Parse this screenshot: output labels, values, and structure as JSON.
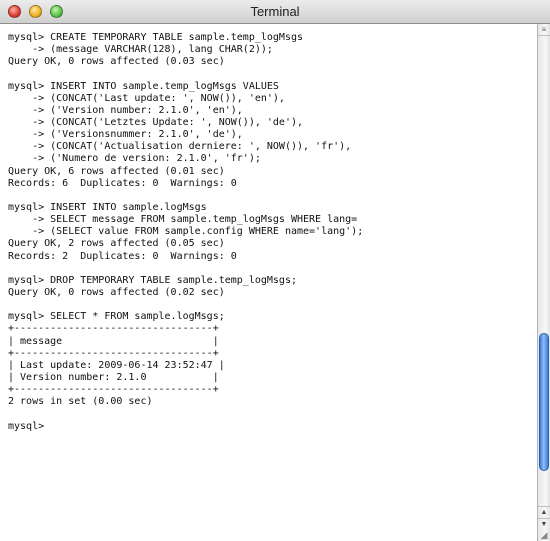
{
  "window": {
    "title": "Terminal"
  },
  "terminal_lines": [
    "mysql> CREATE TEMPORARY TABLE sample.temp_logMsgs",
    "    -> (message VARCHAR(128), lang CHAR(2));",
    "Query OK, 0 rows affected (0.03 sec)",
    "",
    "mysql> INSERT INTO sample.temp_logMsgs VALUES",
    "    -> (CONCAT('Last update: ', NOW()), 'en'),",
    "    -> ('Version number: 2.1.0', 'en'),",
    "    -> (CONCAT('Letztes Update: ', NOW()), 'de'),",
    "    -> ('Versionsnummer: 2.1.0', 'de'),",
    "    -> (CONCAT('Actualisation derniere: ', NOW()), 'fr'),",
    "    -> ('Numero de version: 2.1.0', 'fr');",
    "Query OK, 6 rows affected (0.01 sec)",
    "Records: 6  Duplicates: 0  Warnings: 0",
    "",
    "mysql> INSERT INTO sample.logMsgs",
    "    -> SELECT message FROM sample.temp_logMsgs WHERE lang=",
    "    -> (SELECT value FROM sample.config WHERE name='lang');",
    "Query OK, 2 rows affected (0.05 sec)",
    "Records: 2  Duplicates: 0  Warnings: 0",
    "",
    "mysql> DROP TEMPORARY TABLE sample.temp_logMsgs;",
    "Query OK, 0 rows affected (0.02 sec)",
    "",
    "mysql> SELECT * FROM sample.logMsgs;",
    "+---------------------------------+",
    "| message                         |",
    "+---------------------------------+",
    "| Last update: 2009-06-14 23:52:47 |",
    "| Version number: 2.1.0           |",
    "+---------------------------------+",
    "2 rows in set (0.00 sec)",
    "",
    "mysql>"
  ],
  "icons": {
    "close": "close-icon",
    "minimize": "minimize-icon",
    "zoom": "zoom-icon",
    "scroll_up": "arrow-up-icon",
    "scroll_down": "arrow-down-icon",
    "resize": "resize-grip-icon"
  },
  "colors": {
    "background": "#ffffff",
    "text": "#111111",
    "close": "#e0443a",
    "minimize": "#f0b62d",
    "zoom": "#62c554",
    "scroll_thumb": "#3d7be2"
  },
  "scroll": {
    "position_fraction": 0.9
  }
}
